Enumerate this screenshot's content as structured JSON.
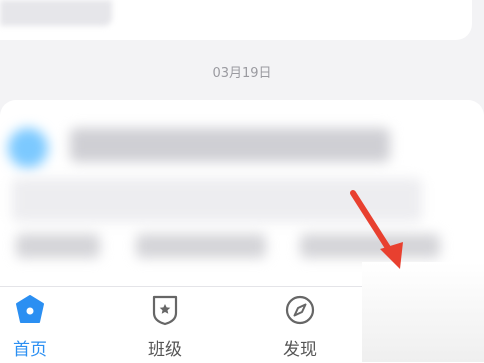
{
  "feed": {
    "date_separator": "03月19日"
  },
  "tabbar": {
    "items": [
      {
        "label": "首页",
        "icon": "home-icon",
        "active": true
      },
      {
        "label": "班级",
        "icon": "class-badge-icon",
        "active": false
      },
      {
        "label": "发现",
        "icon": "compass-icon",
        "active": false
      }
    ]
  },
  "colors": {
    "accent": "#2b8ff2",
    "annotation_arrow": "#e8402f",
    "background": "#f3f3f5"
  }
}
